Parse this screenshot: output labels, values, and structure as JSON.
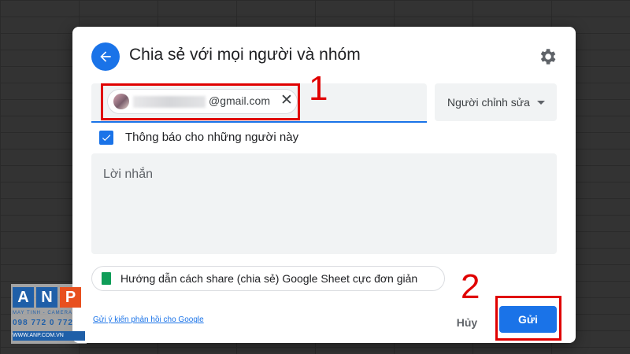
{
  "dialog": {
    "title": "Chia sẻ với mọi người và nhóm",
    "recipient_email_suffix": "@gmail.com",
    "role": "Người chỉnh sửa",
    "notify_label": "Thông báo cho những người này",
    "notify_checked": true,
    "message_placeholder": "Lời nhắn",
    "help_link": "Hướng dẫn cách share (chia sẻ) Google Sheet cực đơn giản",
    "feedback_link": "Gửi ý kiến phản hồi cho Google",
    "cancel_label": "Hủy",
    "send_label": "Gửi",
    "accent_color": "#1a73e8"
  },
  "annotations": {
    "one": "1",
    "two": "2",
    "color": "#e00000"
  },
  "watermark": {
    "letters": [
      "A",
      "N",
      "P"
    ],
    "subtitle": "MAY TINH - CAMERA",
    "phone": "098 772 0 772",
    "url": "WWW.ANP.COM.VN"
  }
}
